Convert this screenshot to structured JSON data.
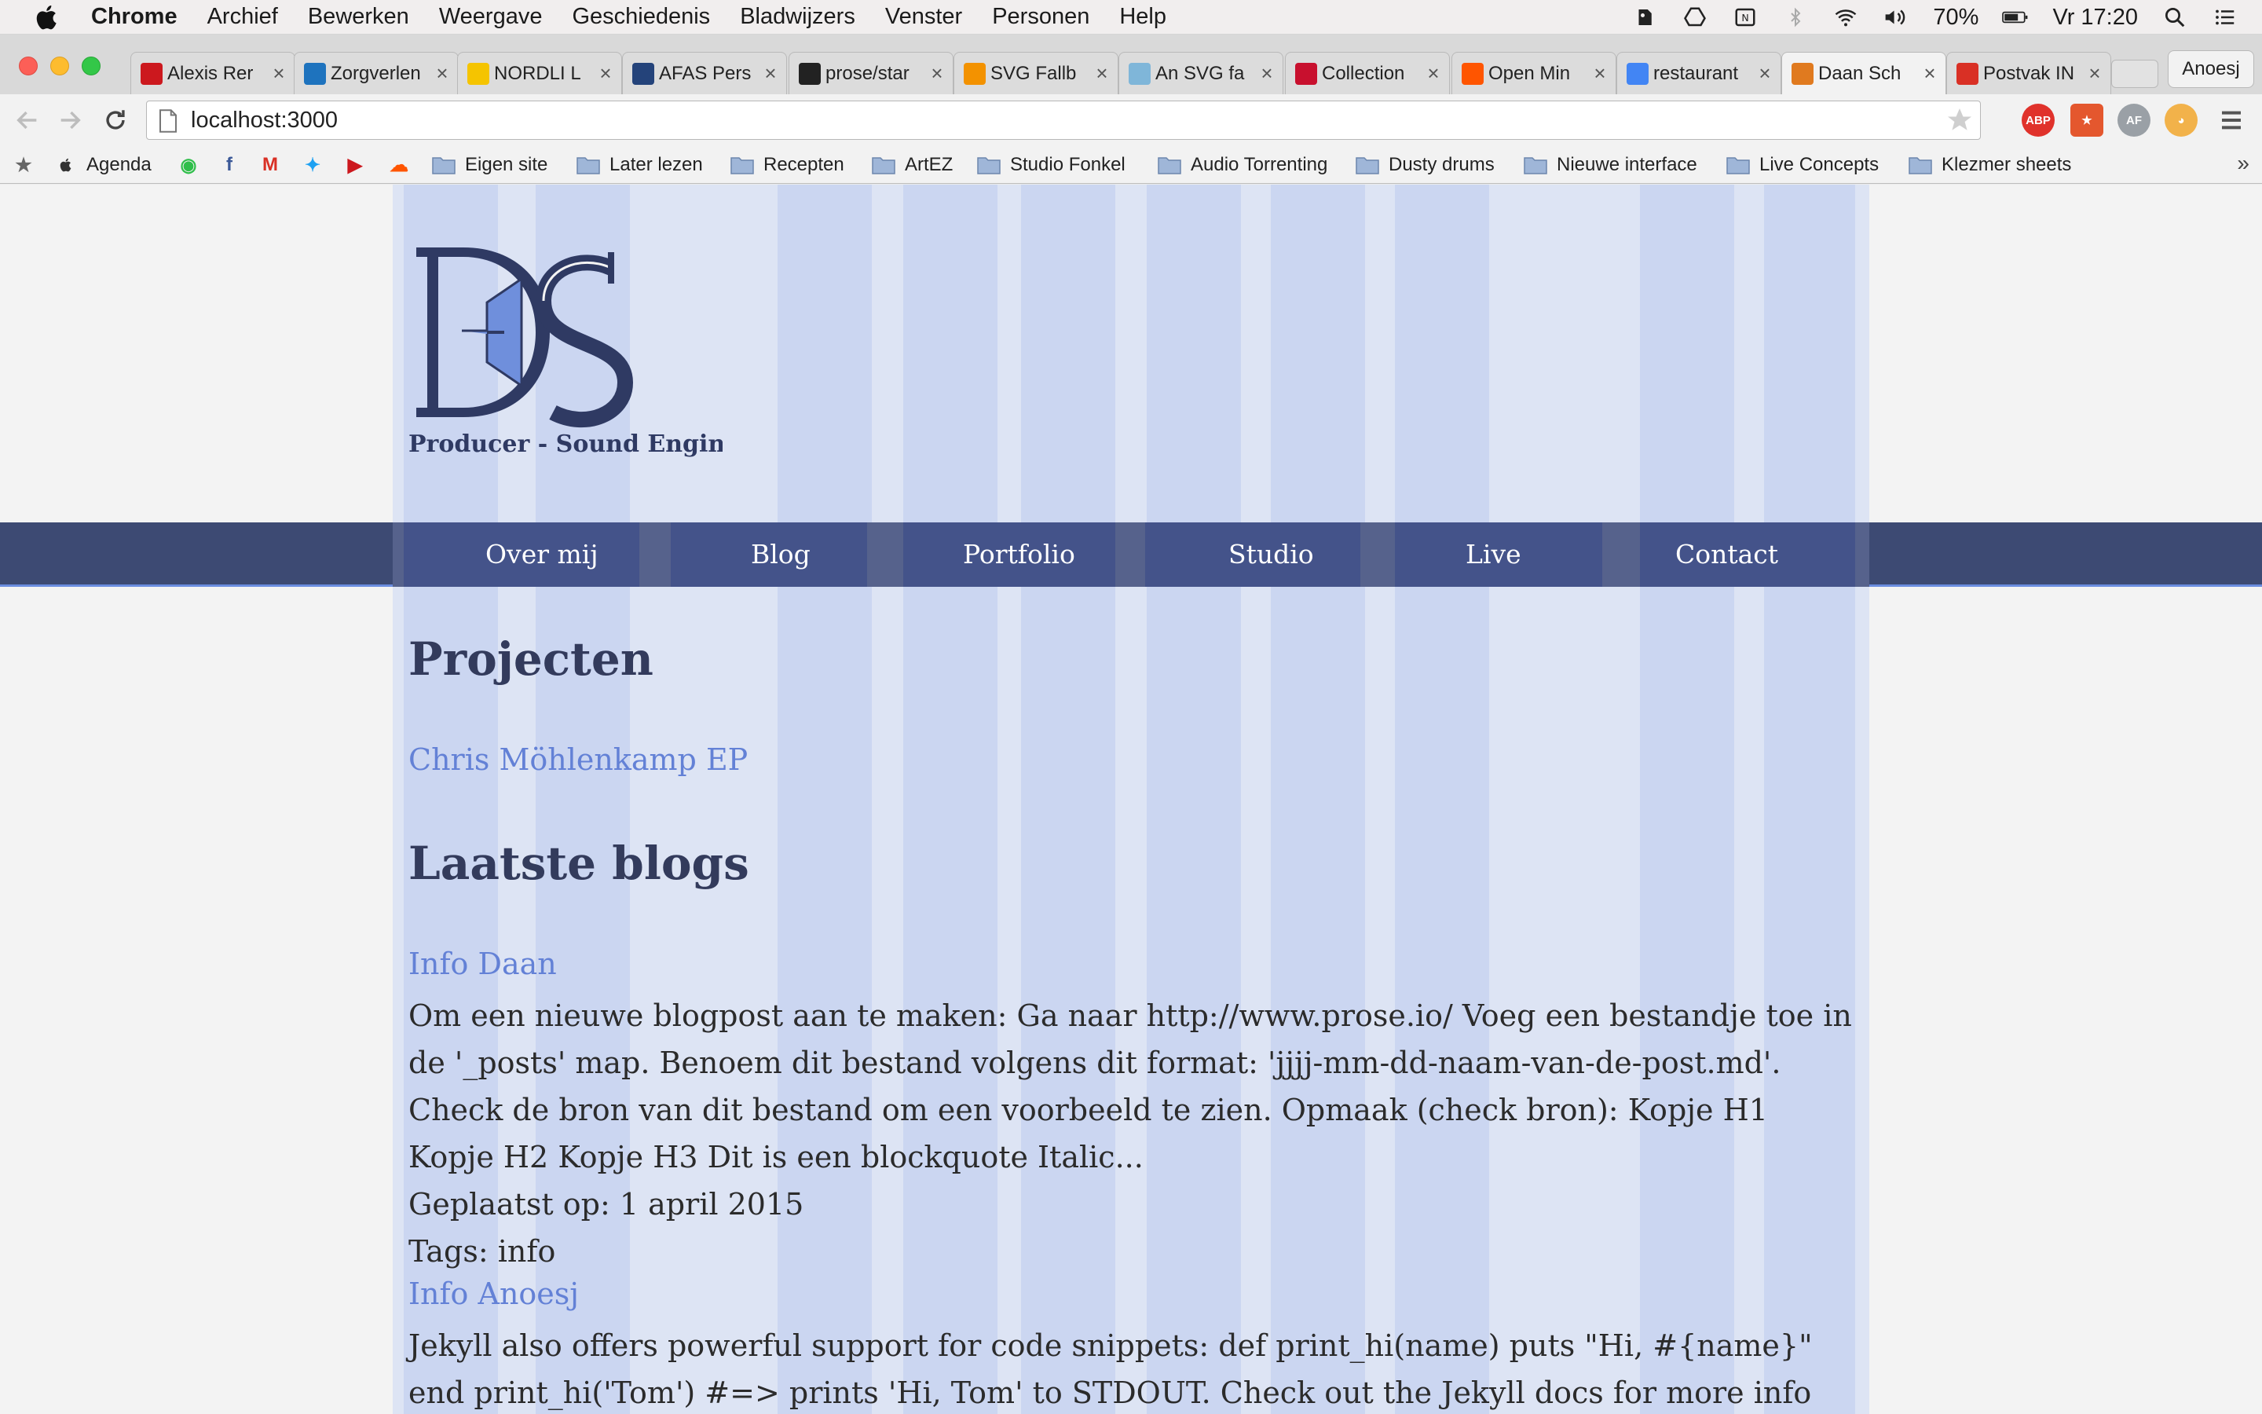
{
  "menubar": {
    "app": "Chrome",
    "items": [
      "Archief",
      "Bewerken",
      "Weergave",
      "Geschiedenis",
      "Bladwijzers",
      "Venster",
      "Personen",
      "Help"
    ],
    "battery": "70%",
    "clock": "Vr 17:20"
  },
  "tabs": [
    {
      "title": "Alexis Rer",
      "favicon": "youtube-icon",
      "color": "#cc181e"
    },
    {
      "title": "Zorgverlen",
      "favicon": "plus-cross-icon",
      "color": "#1e73be"
    },
    {
      "title": "NORDLI L",
      "favicon": "ikea-icon",
      "color": "#f5c400"
    },
    {
      "title": "AFAS Pers",
      "favicon": "afas-icon",
      "color": "#24437a"
    },
    {
      "title": "prose/star",
      "favicon": "github-icon",
      "color": "#222222"
    },
    {
      "title": "SVG Fallb",
      "favicon": "asterisk-icon",
      "color": "#f39200"
    },
    {
      "title": "An SVG fa",
      "favicon": "gear-flower-icon",
      "color": "#7fb6d9"
    },
    {
      "title": "Collection",
      "favicon": "pen-icon",
      "color": "#c8102e"
    },
    {
      "title": "Open Min",
      "favicon": "soundcloud-icon",
      "color": "#ff5500"
    },
    {
      "title": "restaurant",
      "favicon": "google-icon",
      "color": "#4285f4"
    },
    {
      "title": "Daan Sch",
      "favicon": "star-icon",
      "color": "#e07a1f"
    },
    {
      "title": "Postvak IN",
      "favicon": "gmail-icon",
      "color": "#d93025"
    }
  ],
  "profile_name": "Anoesj",
  "url": "localhost:3000",
  "bookmarks": [
    {
      "label": "",
      "kind": "star"
    },
    {
      "label": "Agenda",
      "kind": "apple"
    },
    {
      "label": "",
      "kind": "whatsapp"
    },
    {
      "label": "",
      "kind": "facebook"
    },
    {
      "label": "",
      "kind": "gmail"
    },
    {
      "label": "",
      "kind": "twitter"
    },
    {
      "label": "",
      "kind": "youtube"
    },
    {
      "label": "",
      "kind": "soundcloud"
    },
    {
      "label": "Eigen site",
      "kind": "folder"
    },
    {
      "label": "Later lezen",
      "kind": "folder"
    },
    {
      "label": "Recepten",
      "kind": "folder"
    },
    {
      "label": "ArtEZ",
      "kind": "folder"
    },
    {
      "label": "Studio Fonkel",
      "kind": "folder"
    },
    {
      "label": "Audio Torrenting",
      "kind": "folder"
    },
    {
      "label": "Dusty drums",
      "kind": "folder"
    },
    {
      "label": "Nieuwe interface",
      "kind": "folder"
    },
    {
      "label": "Live Concepts",
      "kind": "folder"
    },
    {
      "label": "Klezmer sheets",
      "kind": "folder"
    }
  ],
  "site": {
    "tagline": "Producer - Sound Engineer",
    "nav": [
      "Over mij",
      "Blog",
      "Portfolio",
      "Studio",
      "Live",
      "Contact"
    ],
    "projects_heading": "Projecten",
    "projects": [
      "Chris Möhlenkamp EP"
    ],
    "blogs_heading": "Laatste blogs",
    "posts": [
      {
        "title": "Info Daan",
        "excerpt": "Om een nieuwe blogpost aan te maken: Ga naar http://www.prose.io/ Voeg een bestandje toe in de '_posts' map. Benoem dit bestand volgens dit format: 'jjjj-mm-dd-naam-van-de-post.md'. Check de bron van dit bestand om een voorbeeld te zien. Opmaak (check bron): Kopje H1 Kopje H2 Kopje H3 Dit is een blockquote Italic...",
        "date_line": "Geplaatst op: 1 april 2015",
        "tags_line": "Tags: info"
      },
      {
        "title": "Info Anoesj",
        "excerpt": "Jekyll also offers powerful support for code snippets: def print_hi(name) puts \"Hi, #{name}\" end print_hi('Tom') #=> prints 'Hi, Tom' to STDOUT. Check out the Jekyll docs for more info on how to"
      }
    ]
  },
  "colors": {
    "nav_bg": "#3d4a73",
    "heading": "#333b5c",
    "link": "#6381d6",
    "grid_col": "#cbd6f1"
  }
}
